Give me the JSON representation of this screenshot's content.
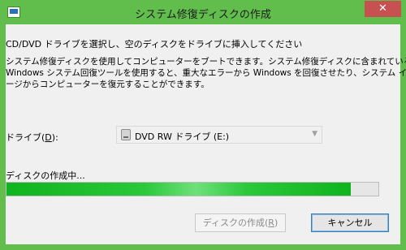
{
  "window": {
    "title": "システム修復ディスクの作成",
    "close_label": "✕"
  },
  "instruction": "CD/DVD ドライブを選択し、空のディスクをドライブに挿入してください",
  "description": [
    "システム修復ディスクを使用してコンピューターをブートできます。システム修復ディスクに含まれている",
    "Windows システム回復ツールを使用すると、重大なエラーから Windows を回復させたり、システム イメ",
    "ージからコンピューターを復元することができます。"
  ],
  "drive": {
    "label_prefix": "ドライブ(",
    "label_key": "D",
    "label_suffix": "):",
    "selected": "DVD RW ドライブ (E:)",
    "icon": "optical-drive-icon"
  },
  "status": "ディスクの作成中...",
  "progress": {
    "fraction": 0.925
  },
  "buttons": {
    "create_prefix": "ディスクの作成(",
    "create_key": "R",
    "create_suffix": ")",
    "cancel": "キャンセル"
  },
  "colors": {
    "titlebar": "#62be4c",
    "close": "#c75050",
    "progress": "#0fb41e"
  }
}
